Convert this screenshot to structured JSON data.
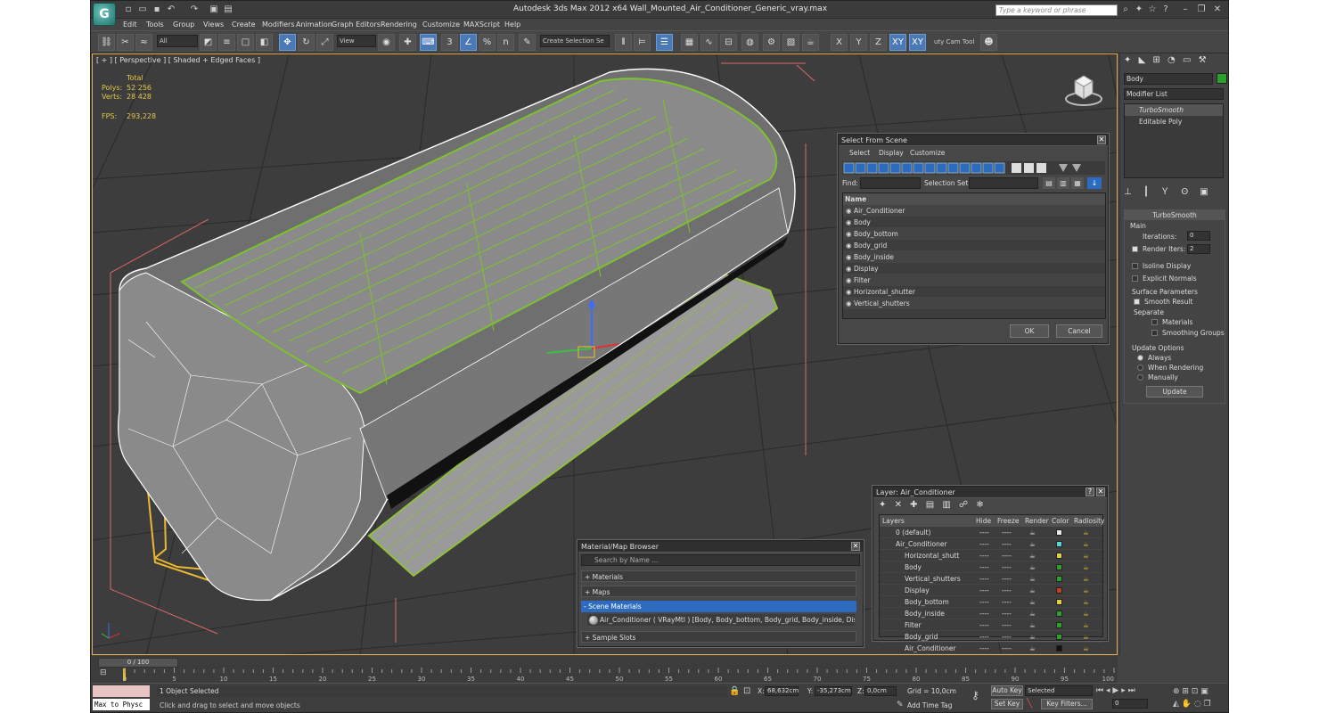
{
  "window": {
    "title": "Autodesk 3ds Max  2012 x64    Wall_Mounted_Air_Conditioner_Generic_vray.max",
    "search_placeholder": "Type a keyword or phrase"
  },
  "menu": [
    "Edit",
    "Tools",
    "Group",
    "Views",
    "Create",
    "Modifiers",
    "Animation",
    "Graph Editors",
    "Rendering",
    "Customize",
    "MAXScript",
    "Help"
  ],
  "toolbar": {
    "filter_value": "All",
    "refcoord_value": "View",
    "selection_set": "Create Selection Se",
    "snaps_labels": [
      "3",
      "%",
      "n"
    ],
    "axis_buttons": [
      "X",
      "Y",
      "Z",
      "XY",
      "XY"
    ],
    "cam_tool_label": "uty Cam Tool"
  },
  "viewport": {
    "label": "[ + ] [ Perspective ] [ Shaded + Edged Faces ]",
    "stats": {
      "total_label": "Total",
      "polys_label": "Polys:",
      "polys_value": "52 256",
      "verts_label": "Verts:",
      "verts_value": "28 428",
      "fps_label": "FPS:",
      "fps_value": "293,228"
    }
  },
  "select_from_scene": {
    "title": "Select From Scene",
    "menu": [
      "Select",
      "Display",
      "Customize"
    ],
    "find_label": "Find:",
    "selection_set_label": "Selection Set:",
    "column_name": "Name",
    "items": [
      "Air_Conditioner",
      "Body",
      "Body_bottom",
      "Body_grid",
      "Body_inside",
      "Display",
      "Filter",
      "Horizontal_shutter",
      "Vertical_shutters"
    ],
    "ok": "OK",
    "cancel": "Cancel"
  },
  "layer_window": {
    "title": "Layer: Air_Conditioner",
    "columns": [
      "Layers",
      "Hide",
      "Freeze",
      "Render",
      "Color",
      "Radiosity"
    ],
    "layers": [
      {
        "name": "0 (default)",
        "indent": 0,
        "color": "#e8e8e8"
      },
      {
        "name": "Air_Conditioner",
        "indent": 0,
        "color": "#5ad6d6"
      },
      {
        "name": "Horizontal_shutt",
        "indent": 1,
        "color": "#e0d040"
      },
      {
        "name": "Body",
        "indent": 1,
        "color": "#2ca02c"
      },
      {
        "name": "Vertical_shutters",
        "indent": 1,
        "color": "#2ca02c"
      },
      {
        "name": "Display",
        "indent": 1,
        "color": "#c04020"
      },
      {
        "name": "Body_bottom",
        "indent": 1,
        "color": "#e0d040"
      },
      {
        "name": "Body_inside",
        "indent": 1,
        "color": "#2ca02c"
      },
      {
        "name": "Filter",
        "indent": 1,
        "color": "#2ca02c"
      },
      {
        "name": "Body_grid",
        "indent": 1,
        "color": "#2ca02c"
      },
      {
        "name": "Air_Conditioner",
        "indent": 1,
        "color": "#111111"
      }
    ],
    "placeholder_dash": "----"
  },
  "material_browser": {
    "title": "Material/Map Browser",
    "search_placeholder": "Search by Name ...",
    "sections": [
      "+ Materials",
      "+ Maps",
      "- Scene Materials"
    ],
    "scene_material": "Air_Conditioner ( VRayMtl ) [Body, Body_bottom, Body_grid, Body_inside, Displ...",
    "sample_slots": "+ Sample Slots"
  },
  "command_panel": {
    "object_name": "Body",
    "modifier_list": "Modifier List",
    "stack": [
      "TurboSmooth",
      "Editable Poly"
    ],
    "rollout_title": "TurboSmooth",
    "main_label": "Main",
    "iterations_label": "Iterations:",
    "iterations_value": "0",
    "render_iters_label": "Render Iters:",
    "render_iters_value": "2",
    "isoline_label": "Isoline Display",
    "explicit_label": "Explicit Normals",
    "surface_label": "Surface Parameters",
    "smooth_result_label": "Smooth Result",
    "separate_label": "Separate",
    "materials_label": "Materials",
    "smoothing_groups_label": "Smoothing Groups",
    "update_options_label": "Update Options",
    "always_label": "Always",
    "when_rendering_label": "When Rendering",
    "manually_label": "Manually",
    "update_button": "Update"
  },
  "timeline": {
    "frame_display": "0 / 100",
    "ticks": [
      "0",
      "5",
      "10",
      "15",
      "20",
      "25",
      "30",
      "35",
      "40",
      "45",
      "50",
      "55",
      "60",
      "65",
      "70",
      "75",
      "80",
      "85",
      "90",
      "95",
      "100"
    ]
  },
  "status": {
    "maxscript": "Max to Physc",
    "selected_text": "1 Object Selected",
    "prompt_text": "Click and drag to select and move objects",
    "x_label": "X:",
    "x_value": "68,632cm",
    "y_label": "Y:",
    "y_value": "-35,273cm",
    "z_label": "Z:",
    "z_value": "0,0cm",
    "grid": "Grid = 10,0cm",
    "add_time_tag": "Add Time Tag",
    "auto_key": "Auto Key",
    "set_key": "Set Key",
    "selected_dropdown": "Selected",
    "key_filters": "Key Filters...",
    "frame_value": "0"
  }
}
